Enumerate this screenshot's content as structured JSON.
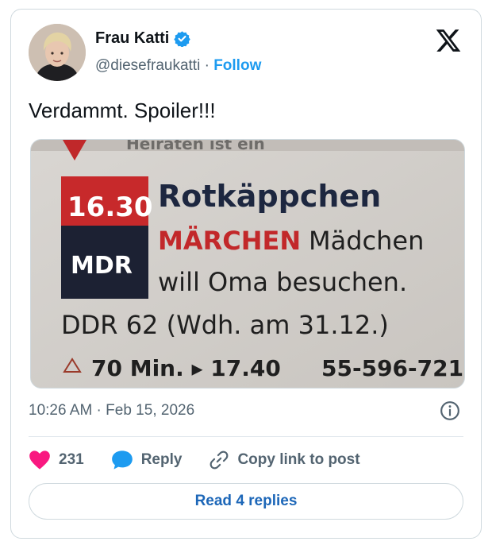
{
  "author": {
    "display_name": "Frau Katti",
    "handle": "@diesefraukatti",
    "separator": "·",
    "follow_label": "Follow",
    "verified_color": "#1d9bf0"
  },
  "tweet": {
    "text": "Verdammt. Spoiler!!!",
    "timestamp": "10:26 AM · Feb 15, 2026"
  },
  "media": {
    "time": "16.30",
    "channel": "MDR",
    "title": "Rotkäppchen",
    "genre": "MÄRCHEN",
    "desc_line1": "Mädchen",
    "desc_line2": "will Oma besuchen.",
    "origin_line": "DDR 62 (Wdh. am 31.12.)",
    "duration": "70 Min. ▸ 17.40",
    "code": "55-596-721",
    "top_partial": "Heiraten ist ein"
  },
  "actions": {
    "like_count": "231",
    "reply_label": "Reply",
    "copy_label": "Copy link to post",
    "read_replies_label": "Read 4 replies"
  },
  "colors": {
    "like": "#f91880",
    "link": "#1d9bf0",
    "muted": "#536471"
  }
}
